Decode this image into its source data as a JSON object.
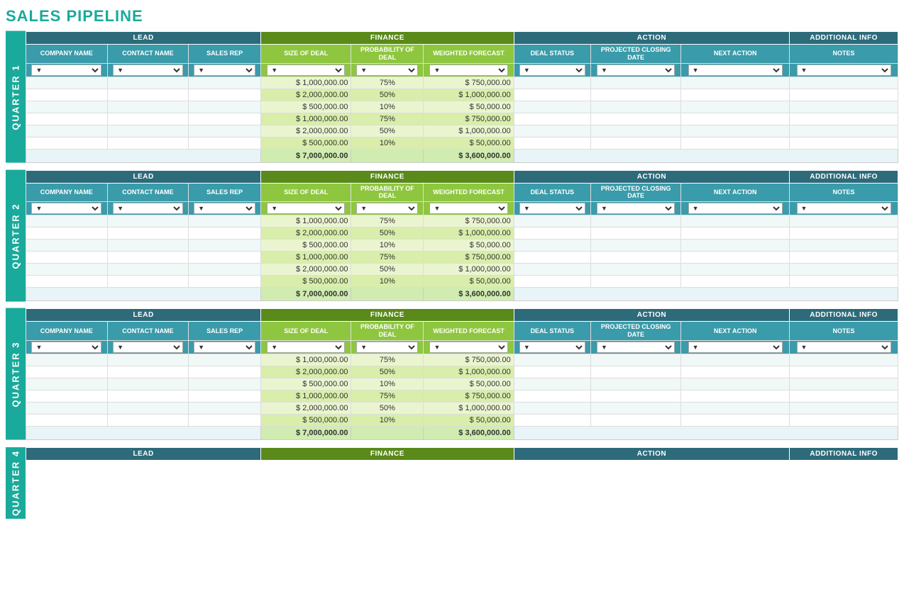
{
  "page": {
    "title": "SALES PIPELINE"
  },
  "quarters": [
    {
      "label": "QUARTER 1",
      "id": "q1"
    },
    {
      "label": "QUARTER 2",
      "id": "q2"
    },
    {
      "label": "QUARTER 3",
      "id": "q3"
    },
    {
      "label": "QUARTER 4",
      "id": "q4"
    }
  ],
  "sections": {
    "lead": "LEAD",
    "finance": "FINANCE",
    "action": "ACTION",
    "additional_info": "ADDITIONAL INFO"
  },
  "column_headers": {
    "company_name": "COMPANY NAME",
    "contact_name": "CONTACT NAME",
    "sales_rep": "SALES REP",
    "size_of_deal": "SIZE OF DEAL",
    "probability_of_deal": "PROBABILITY OF DEAL",
    "weighted_forecast": "WEIGHTED FORECAST",
    "deal_status": "DEAL STATUS",
    "projected_closing_date": "PROJECTED CLOSING DATE",
    "next_action": "NEXT ACTION",
    "notes": "NOTES"
  },
  "rows": [
    {
      "size": "$ 1,000,000.00",
      "prob": "75%",
      "weighted": "$ 750,000.00"
    },
    {
      "size": "$ 2,000,000.00",
      "prob": "50%",
      "weighted": "$ 1,000,000.00"
    },
    {
      "size": "$ 500,000.00",
      "prob": "10%",
      "weighted": "$ 50,000.00"
    },
    {
      "size": "$ 1,000,000.00",
      "prob": "75%",
      "weighted": "$ 750,000.00"
    },
    {
      "size": "$ 2,000,000.00",
      "prob": "50%",
      "weighted": "$ 1,000,000.00"
    },
    {
      "size": "$ 500,000.00",
      "prob": "10%",
      "weighted": "$ 50,000.00"
    }
  ],
  "totals": {
    "size": "$ 7,000,000.00",
    "weighted": "$ 3,600,000.00"
  },
  "filter_placeholder": "▼"
}
